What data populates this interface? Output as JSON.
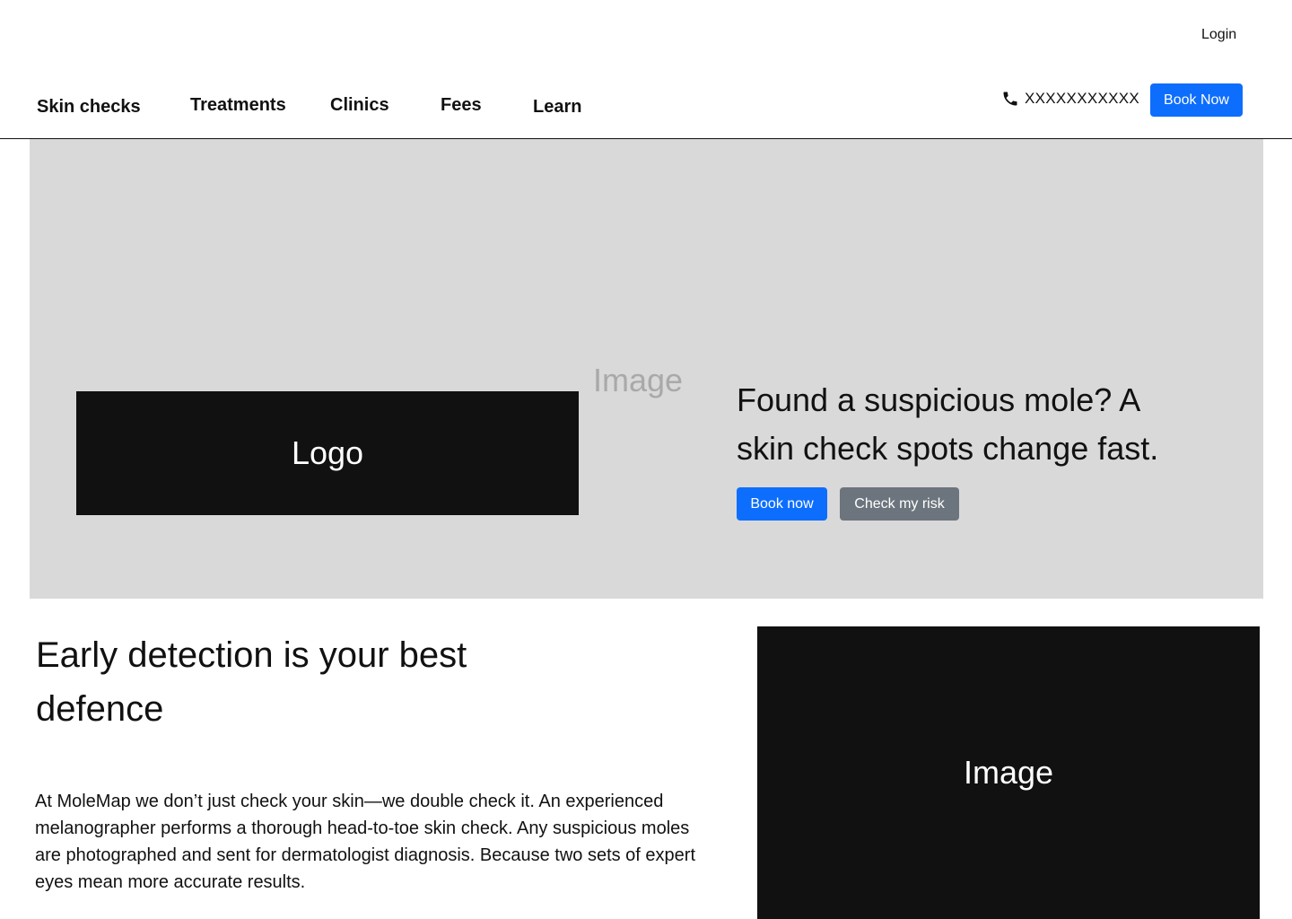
{
  "header": {
    "login_label": "Login",
    "nav": [
      "Skin checks",
      "Treatments",
      "Clinics",
      "Fees",
      "Learn"
    ],
    "phone_icon": "phone-icon",
    "phone_number": "XXXXXXXXXXX",
    "book_now_label": "Book Now"
  },
  "hero": {
    "logo_label": "Logo",
    "image_label": "Image",
    "headline": "Found a suspicious mole? A skin check spots change fast.",
    "book_label": "Book now",
    "risk_label": "Check my risk"
  },
  "section": {
    "heading": " Early detection is your best defence",
    "body": "At MoleMap we don’t just check your skin—we double check it. An experienced melanographer performs a thorough head-to-toe skin check. Any suspicious moles are photographed and sent for dermatologist diagnosis. Because two sets of expert eyes mean more accurate results.",
    "image_label": "Image"
  },
  "colors": {
    "primary": "#0d6efd",
    "secondary": "#6c757d",
    "hero_bg": "#d9d9d9",
    "placeholder_dark": "#111111"
  }
}
